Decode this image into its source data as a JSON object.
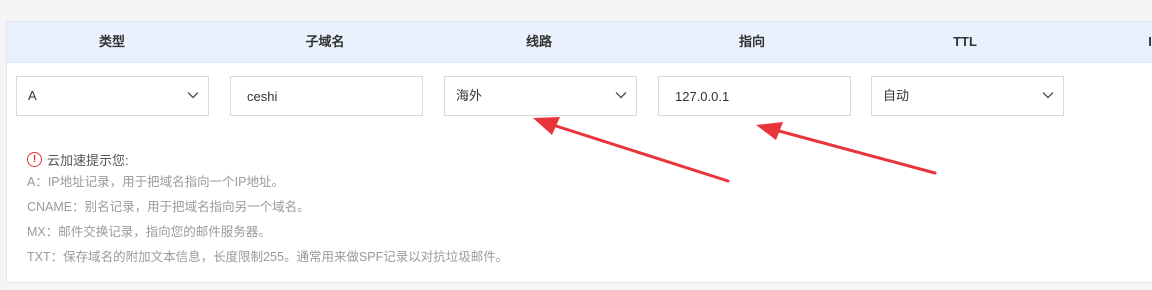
{
  "columns": [
    "类型",
    "子域名",
    "线路",
    "指向",
    "TTL"
  ],
  "form": {
    "type_value": "A",
    "subdomain_value": "ceshi",
    "line_value": "海外",
    "target_value": "127.0.0.1",
    "ttl_value": "自动"
  },
  "tips": {
    "title": "云加速提示您:",
    "lines": [
      "A：IP地址记录，用于把域名指向一个IP地址。",
      "CNAME：别名记录，用于把域名指向另一个域名。",
      "MX：邮件交换记录，指向您的邮件服务器。",
      "TXT：保存域名的附加文本信息，长度限制255。通常用来做SPF记录以对抗垃圾邮件。"
    ]
  },
  "colors": {
    "header_bg": "#e9f2fc",
    "warning": "#e5322d",
    "annotation_arrow": "#e8353b"
  },
  "icons": {
    "dropdown": "chevron-down-icon",
    "warning": "exclamation-circle-icon",
    "annotation": "red-arrow-icon"
  }
}
